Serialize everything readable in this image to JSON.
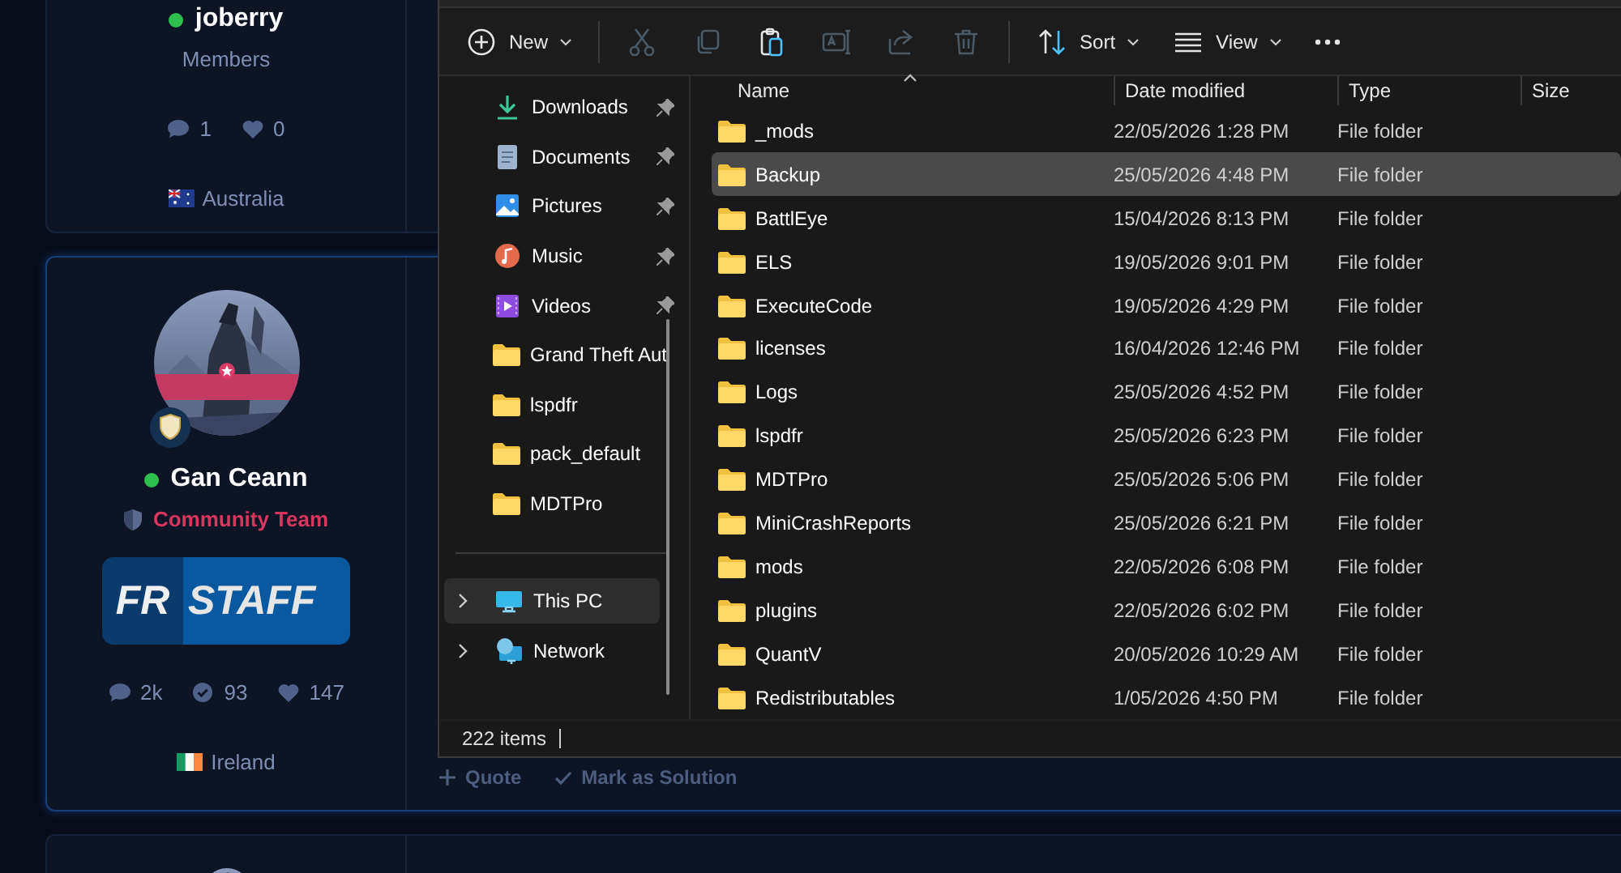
{
  "forum": {
    "cards": [
      {
        "kind": "partial",
        "username": "joberry",
        "online": true,
        "group": {
          "label": "Members",
          "color": "#7e8fb3",
          "shield": false
        },
        "stats": [
          {
            "kind": "posts",
            "value": "1"
          },
          {
            "kind": "likes",
            "value": "0"
          }
        ],
        "country": {
          "kind": "australia",
          "label": "Australia"
        }
      },
      {
        "kind": "full",
        "username": "Gan Ceann",
        "online": true,
        "group": {
          "label": "Community Team",
          "color": "#d8365f",
          "shield": true
        },
        "banner": {
          "left": "FR",
          "right": "STAFF"
        },
        "stats": [
          {
            "kind": "posts",
            "value": "2k"
          },
          {
            "kind": "solutions",
            "value": "93"
          },
          {
            "kind": "likes",
            "value": "147"
          }
        ],
        "country": {
          "kind": "ireland",
          "label": "Ireland"
        },
        "post_actions": [
          {
            "kind": "quote",
            "label": "Quote"
          },
          {
            "kind": "solution",
            "label": "Mark as Solution"
          }
        ]
      },
      {
        "kind": "stub"
      }
    ]
  },
  "explorer": {
    "toolbar": [
      [
        {
          "kind": "new",
          "label": "New",
          "menu": true,
          "disabled": false
        }
      ],
      [
        {
          "kind": "cut",
          "disabled": true
        },
        {
          "kind": "copy",
          "disabled": true
        },
        {
          "kind": "paste",
          "disabled": false
        },
        {
          "kind": "rename",
          "disabled": true
        },
        {
          "kind": "share",
          "disabled": true
        },
        {
          "kind": "delete",
          "disabled": true
        }
      ],
      [
        {
          "kind": "sort",
          "label": "Sort",
          "menu": true,
          "disabled": false
        },
        {
          "kind": "view",
          "label": "View",
          "menu": true,
          "disabled": false
        },
        {
          "kind": "more",
          "disabled": false
        }
      ]
    ],
    "quick_access": [
      {
        "kind": "downloads",
        "label": "Downloads",
        "pinned": true
      },
      {
        "kind": "documents",
        "label": "Documents",
        "pinned": true
      },
      {
        "kind": "pictures",
        "label": "Pictures",
        "pinned": true
      },
      {
        "kind": "music",
        "label": "Music",
        "pinned": true
      },
      {
        "kind": "videos",
        "label": "Videos",
        "pinned": true
      },
      {
        "kind": "folder",
        "label": "Grand Theft Aut",
        "pinned": false
      },
      {
        "kind": "folder",
        "label": "lspdfr",
        "pinned": false
      },
      {
        "kind": "folder",
        "label": "pack_default",
        "pinned": false
      },
      {
        "kind": "folder",
        "label": "MDTPro",
        "pinned": false
      }
    ],
    "tree": [
      {
        "kind": "pc",
        "label": "This PC",
        "selected": true
      },
      {
        "kind": "network",
        "label": "Network",
        "selected": false
      }
    ],
    "columns": [
      {
        "label": "Name",
        "sorted": true
      },
      {
        "label": "Date modified",
        "sorted": false
      },
      {
        "label": "Type",
        "sorted": false
      },
      {
        "label": "Size",
        "sorted": false
      }
    ],
    "rows": [
      {
        "name": "_mods",
        "date": "22/05/2026 1:28 PM",
        "type": "File folder",
        "selected": false
      },
      {
        "name": "Backup",
        "date": "25/05/2026 4:48 PM",
        "type": "File folder",
        "selected": true
      },
      {
        "name": "BattlEye",
        "date": "15/04/2026 8:13 PM",
        "type": "File folder",
        "selected": false
      },
      {
        "name": "ELS",
        "date": "19/05/2026 9:01 PM",
        "type": "File folder",
        "selected": false
      },
      {
        "name": "ExecuteCode",
        "date": "19/05/2026 4:29 PM",
        "type": "File folder",
        "selected": false
      },
      {
        "name": "licenses",
        "date": "16/04/2026 12:46 PM",
        "type": "File folder",
        "selected": false
      },
      {
        "name": "Logs",
        "date": "25/05/2026 4:52 PM",
        "type": "File folder",
        "selected": false
      },
      {
        "name": "lspdfr",
        "date": "25/05/2026 6:23 PM",
        "type": "File folder",
        "selected": false
      },
      {
        "name": "MDTPro",
        "date": "25/05/2026 5:06 PM",
        "type": "File folder",
        "selected": false
      },
      {
        "name": "MiniCrashReports",
        "date": "25/05/2026 6:21 PM",
        "type": "File folder",
        "selected": false
      },
      {
        "name": "mods",
        "date": "22/05/2026 6:08 PM",
        "type": "File folder",
        "selected": false
      },
      {
        "name": "plugins",
        "date": "22/05/2026 6:02 PM",
        "type": "File folder",
        "selected": false
      },
      {
        "name": "QuantV",
        "date": "20/05/2026 10:29 AM",
        "type": "File folder",
        "selected": false
      },
      {
        "name": "Redistributables",
        "date": "1/05/2026 4:50 PM",
        "type": "File folder",
        "selected": false
      }
    ],
    "status": "222 items"
  }
}
